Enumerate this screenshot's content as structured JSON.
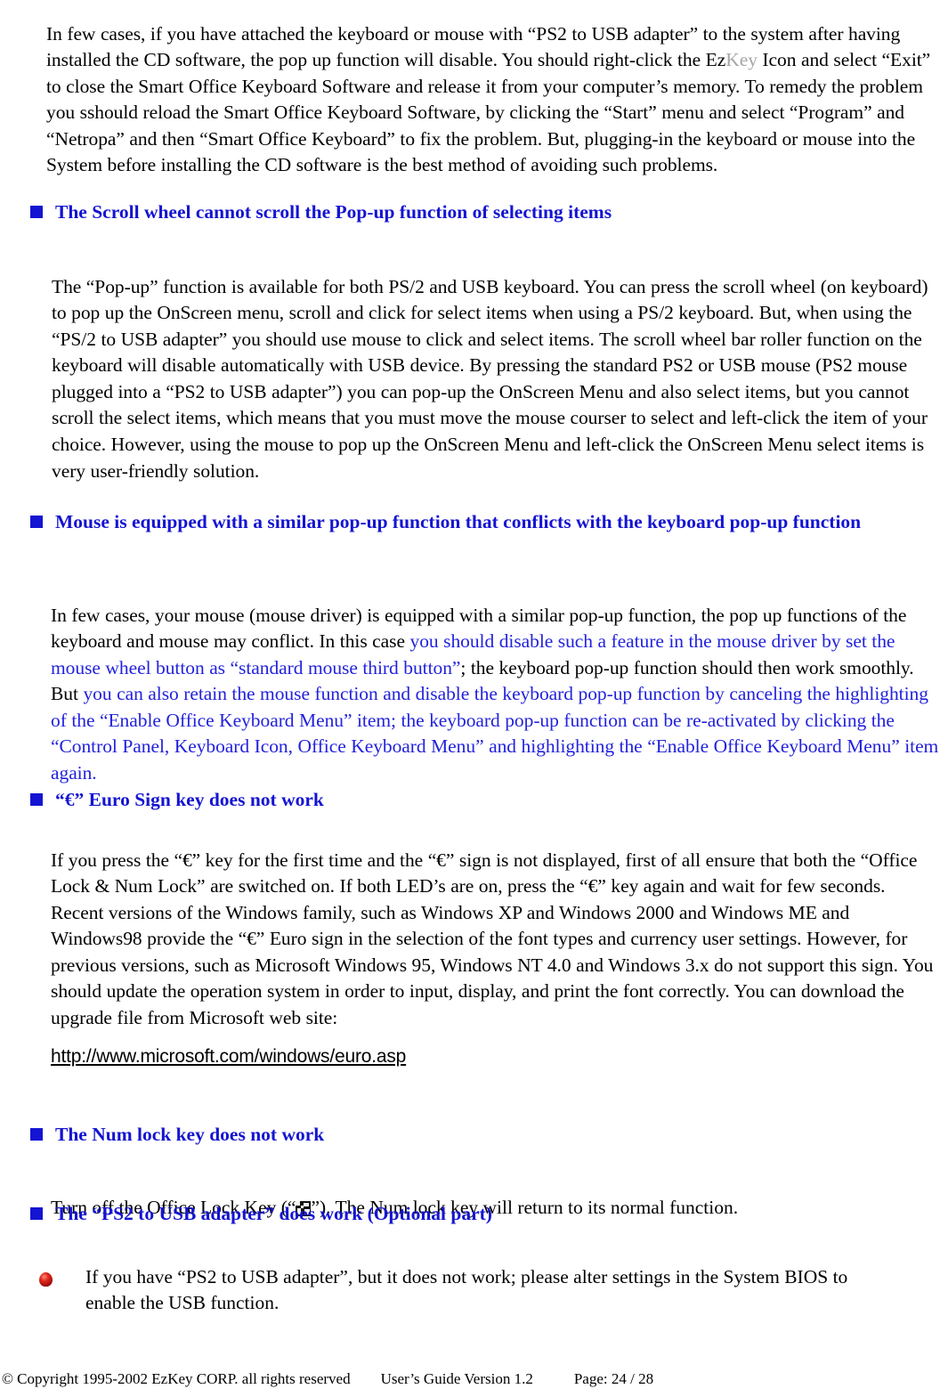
{
  "document": {
    "type": "user-guide-page",
    "colors": {
      "heading_blue": "#1414d2",
      "body_black": "#000000",
      "blue_run": "#2222dd",
      "ezkey_grey": "#a6a6a6",
      "ball_red": "#a60d0a"
    }
  },
  "intro_paragraph": {
    "part1": "In few cases, if you have attached the keyboard or mouse with “PS2 to USB adapter” to the system after having installed the CD software, the pop up function will disable. You should right-click the Ez",
    "brand_grey": "Key",
    "part2": " Icon and select “Exit” to close the Smart Office Keyboard Software and release it from your computer’s memory. To remedy the problem you sshould reload the Smart Office Keyboard Software, by clicking the “Start” menu and select “Program” and “Netropa” and then “Smart Office Keyboard” to fix the problem. But, plugging-in the keyboard or mouse into the System before installing the CD software is the best method of avoiding such problems."
  },
  "section_scroll": {
    "heading": "The Scroll wheel cannot scroll the Pop-up function of selecting items",
    "paragraph": "The “Pop-up” function is available for both PS/2 and USB keyboard. You can press the scroll wheel (on keyboard) to pop up the OnScreen menu, scroll and click for select items when using a PS/2 keyboard. But, when using the “PS/2 to USB adapter” you should use mouse to click and select items. The scroll wheel bar roller function on the keyboard will disable automatically with USB device. By pressing the standard PS2 or USB mouse (PS2 mouse plugged into a “PS2 to USB adapter”) you can pop-up the OnScreen Menu and also select items, but you cannot scroll the select items, which means that you must move the mouse courser to select and left-click the item of your choice. However, using the mouse to pop up the OnScreen Menu and left-click the OnScreen Menu select items is very user-friendly solution."
  },
  "section_mouse": {
    "heading": "Mouse is equipped with a similar pop-up function that conflicts with the keyboard pop-up function",
    "para_black1": "In few cases, your mouse (mouse driver) is equipped with a similar pop-up function, the pop up functions of the keyboard and mouse may conflict. In this case ",
    "para_blue1": "you should disable such a feature in the mouse driver by set the mouse wheel button as “standard mouse third button”",
    "para_black2": "; the keyboard pop-up function should then work smoothly. But ",
    "para_blue2": "you can also retain the mouse function and disable the keyboard pop-up function by canceling the highlighting of the “Enable Office Keyboard Menu” item; the keyboard pop-up function can be re-activated by clicking the “Control Panel, Keyboard Icon, Office Keyboard Menu” and highlighting the “Enable Office Keyboard Menu” item again."
  },
  "section_euro": {
    "heading": "“€” Euro Sign key does not work",
    "paragraph": "If you press the “€” key for the first time and the “€” sign is not displayed, first of all ensure that both the “Office Lock & Num Lock” are switched on. If both LED’s are on, press the “€” key again and wait for few seconds. Recent versions of the Windows family, such as Windows XP and Windows 2000 and Windows ME and Windows98 provide the “€” Euro sign in the selection of the font types and currency user settings. However, for previous versions, such as Microsoft Windows 95, Windows NT 4.0 and Windows 3.x do not support this sign. You should update the operation system in order to input, display, and print the font correctly. You can download the upgrade file from Microsoft web site:",
    "url": "http://www.microsoft.com/windows/euro.asp"
  },
  "section_numlock": {
    "heading": "The Num lock key does not work",
    "text_before_icon": "Turn off the Office Lock Key (“",
    "icon_name": "office-lock-key-icon",
    "text_after_icon": "”). The Num lock key will return to its normal function."
  },
  "section_ps2": {
    "heading": "The “PS2 to USB adapter” does work (Optional part)",
    "bullet_text": "If you have “PS2 to USB adapter”, but it does not work; please alter settings in the System BIOS to enable the USB function."
  },
  "footer": {
    "copyright": "© Copyright 1995-2002 EzKey CORP. all rights reserved",
    "guide": "User’s Guide Version 1.2",
    "page": "Page: 24 / 28"
  }
}
